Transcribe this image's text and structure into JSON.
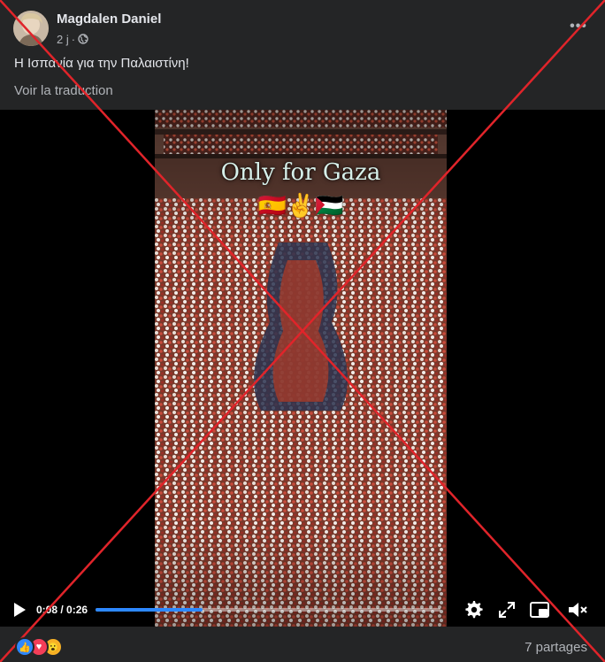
{
  "post": {
    "author": "Magdalen Daniel",
    "time": "2 j",
    "separator": "·",
    "privacy_icon": "globe-icon",
    "more_icon": "more-horizontal-icon",
    "more_label": "•••",
    "text": "Η Ισπανία για την Παλαιστίνη!",
    "translate_label": "Voir la traduction"
  },
  "video": {
    "overlay_title": "Only for Gaza",
    "overlay_emojis": "🇪🇸✌️🇵🇸",
    "current_time": "0:08",
    "duration": "0:26",
    "time_display": "0:08 / 0:26",
    "progress": 0.31,
    "icons": [
      "play-icon",
      "settings-icon",
      "fullscreen-icon",
      "picture-in-picture-icon",
      "volume-muted-icon"
    ]
  },
  "footer": {
    "reactions": [
      "like-icon",
      "love-icon",
      "wow-icon"
    ],
    "shares": "7 partages"
  },
  "colors": {
    "background": "#242526",
    "text_primary": "#e4e6eb",
    "text_secondary": "#b0b3b8",
    "progress": "#2d88ff",
    "overlay_x": "#e0242a",
    "like": "#2d88ff",
    "love": "#f33e58",
    "wow": "#f7b125"
  }
}
